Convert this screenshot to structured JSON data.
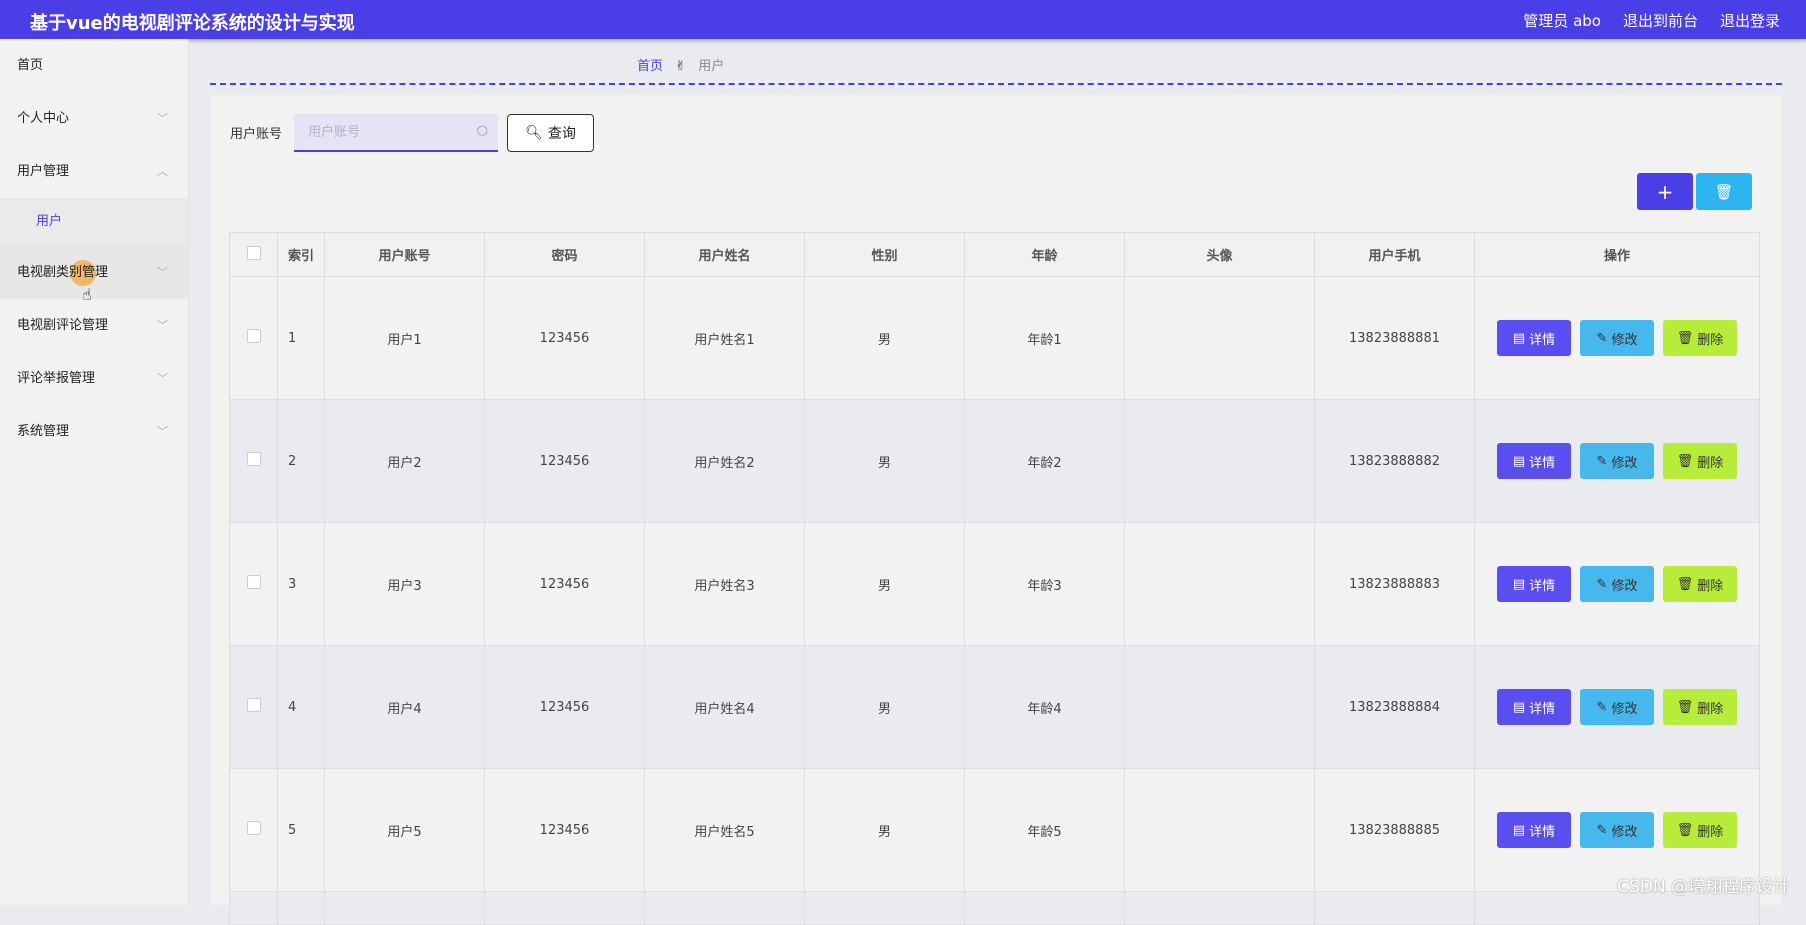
{
  "header": {
    "title": "基于vue的电视剧评论系统的设计与实现",
    "admin": "管理员 abo",
    "to_front": "退出到前台",
    "logout": "退出登录"
  },
  "sidebar": {
    "items": [
      {
        "label": "首页",
        "chevron": ""
      },
      {
        "label": "个人中心",
        "chevron": "﹀"
      },
      {
        "label": "用户管理",
        "chevron": "︿"
      },
      {
        "label": "用户",
        "chevron": ""
      },
      {
        "label": "电视剧类别管理",
        "chevron": "﹀"
      },
      {
        "label": "电视剧评论管理",
        "chevron": "﹀"
      },
      {
        "label": "评论举报管理",
        "chevron": "﹀"
      },
      {
        "label": "系统管理",
        "chevron": "﹀"
      }
    ]
  },
  "breadcrumb": {
    "home": "首页",
    "hand": "✌",
    "current": "用户"
  },
  "search": {
    "label": "用户账号",
    "placeholder": "用户账号",
    "value": "",
    "button": "查询",
    "search_icon": "search-icon"
  },
  "toolbar": {
    "add": "+",
    "delete_icon": "trash-icon"
  },
  "table": {
    "headers": [
      "索引",
      "用户账号",
      "密码",
      "用户姓名",
      "性别",
      "年龄",
      "头像",
      "用户手机",
      "操作"
    ],
    "rows": [
      {
        "idx": "1",
        "account": "用户1",
        "password": "123456",
        "name": "用户姓名1",
        "gender": "男",
        "age": "年龄1",
        "avatar": "",
        "phone": "13823888881"
      },
      {
        "idx": "2",
        "account": "用户2",
        "password": "123456",
        "name": "用户姓名2",
        "gender": "男",
        "age": "年龄2",
        "avatar": "",
        "phone": "13823888882"
      },
      {
        "idx": "3",
        "account": "用户3",
        "password": "123456",
        "name": "用户姓名3",
        "gender": "男",
        "age": "年龄3",
        "avatar": "",
        "phone": "13823888883"
      },
      {
        "idx": "4",
        "account": "用户4",
        "password": "123456",
        "name": "用户姓名4",
        "gender": "男",
        "age": "年龄4",
        "avatar": "",
        "phone": "13823888884"
      },
      {
        "idx": "5",
        "account": "用户5",
        "password": "123456",
        "name": "用户姓名5",
        "gender": "男",
        "age": "年龄5",
        "avatar": "",
        "phone": "13823888885"
      }
    ],
    "actions": {
      "detail": "详情",
      "edit": "修改",
      "delete": "删除"
    }
  },
  "watermark": "CSDN @增翔程序设计",
  "colors": {
    "primary": "#4a3ee6",
    "info": "#2cb4ef",
    "warn": "#b7ec3b"
  }
}
